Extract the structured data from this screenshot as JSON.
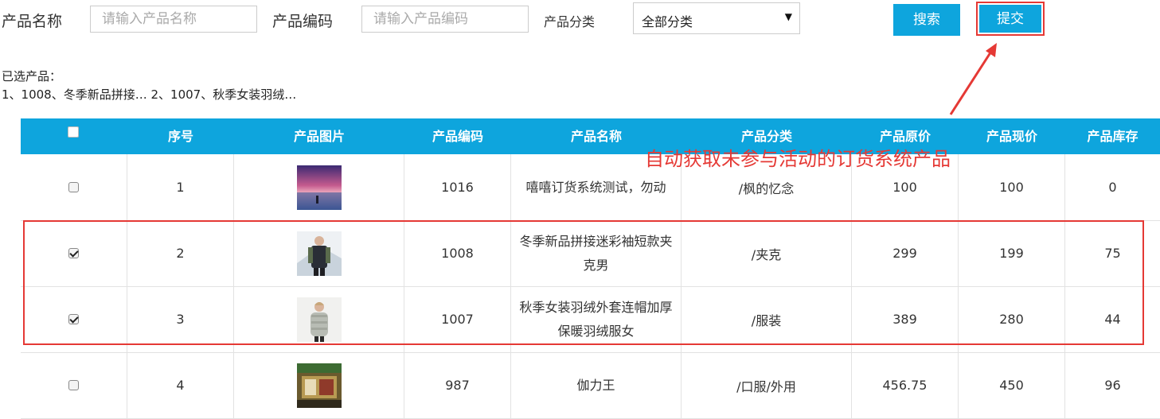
{
  "search": {
    "name_label": "产品名称",
    "name_placeholder": "请输入产品名称",
    "code_label": "产品编码",
    "code_placeholder": "请输入产品编码",
    "category_label": "产品分类",
    "category_selected": "全部分类",
    "search_button": "搜索",
    "submit_button": "提交"
  },
  "selected": {
    "title": "已选产品：",
    "list": "1、1008、冬季新品拼接… 2、1007、秋季女装羽绒…"
  },
  "table": {
    "headers": [
      "序号",
      "产品图片",
      "产品编码",
      "产品名称",
      "产品分类",
      "产品原价",
      "产品现价",
      "产品库存"
    ],
    "rows": [
      {
        "checked": false,
        "index": "1",
        "code": "1016",
        "name": "嘻嘻订货系统测试，勿动",
        "category": "/枫的忆念",
        "original_price": "100",
        "current_price": "100",
        "stock": "0",
        "image": "sunset-photo"
      },
      {
        "checked": true,
        "index": "2",
        "code": "1008",
        "name": "冬季新品拼接迷彩袖短款夹克男",
        "category": "/夹克",
        "original_price": "299",
        "current_price": "199",
        "stock": "75",
        "image": "man-jacket-photo"
      },
      {
        "checked": true,
        "index": "3",
        "code": "1007",
        "name": "秋季女装羽绒外套连帽加厚保暖羽绒服女",
        "category": "/服装",
        "original_price": "389",
        "current_price": "280",
        "stock": "44",
        "image": "woman-down-coat-photo"
      },
      {
        "checked": false,
        "index": "4",
        "code": "987",
        "name": "伽力王",
        "category": "/口服/外用",
        "original_price": "456.75",
        "current_price": "450",
        "stock": "96",
        "image": "product-box-photo"
      }
    ]
  },
  "annotation": {
    "text": "自动获取未参与活动的订货系统产品",
    "color": "#e53935"
  },
  "colors": {
    "accent": "#0ea5dd",
    "highlight": "#e53935"
  }
}
